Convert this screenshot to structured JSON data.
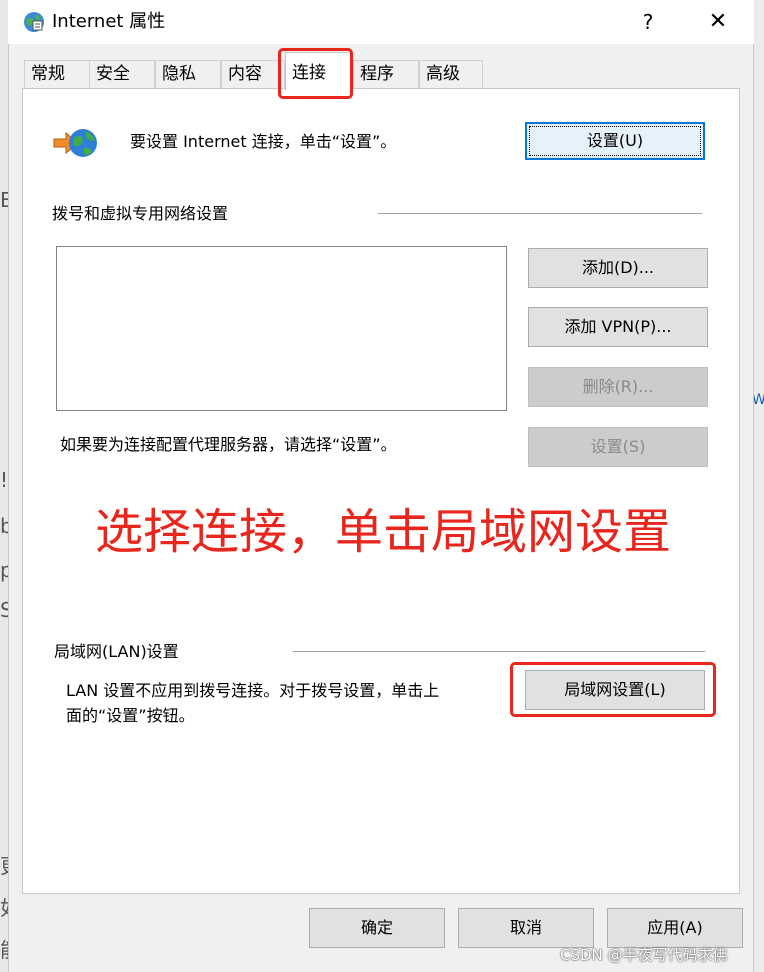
{
  "window": {
    "title": "Internet 属性",
    "help": "?",
    "close": "✕"
  },
  "tabs": [
    "常规",
    "安全",
    "隐私",
    "内容",
    "连接",
    "程序",
    "高级"
  ],
  "active_tab": "连接",
  "setup": {
    "description": "要设置 Internet 连接，单击“设置”。",
    "button": "设置(U)"
  },
  "dialup": {
    "heading": "拨号和虚拟专用网络设置",
    "add_button": "添加(D)...",
    "add_vpn_button": "添加 VPN(P)...",
    "remove_button": "删除(R)...",
    "proxy_hint": "如果要为连接配置代理服务器，请选择“设置”。",
    "settings_button": "设置(S)"
  },
  "annotation": "选择连接，单击局域网设置",
  "lan": {
    "heading": "局域网(LAN)设置",
    "description_line1": "LAN 设置不应用到拨号连接。对于拨号设置，单击上",
    "description_line2": "面的“设置”按钮。",
    "button": "局域网设置(L)"
  },
  "footer": {
    "ok": "确定",
    "cancel": "取消",
    "apply": "应用(A)"
  },
  "watermark": "CSDN @半夜写代码求佛",
  "background": {
    "left_glyphs": [
      "B",
      "!",
      "b",
      "p",
      "S",
      "更",
      "如",
      "能"
    ],
    "right_glyph": "W"
  },
  "colors": {
    "annotation": "#e8261d",
    "focus": "#0078d7"
  }
}
